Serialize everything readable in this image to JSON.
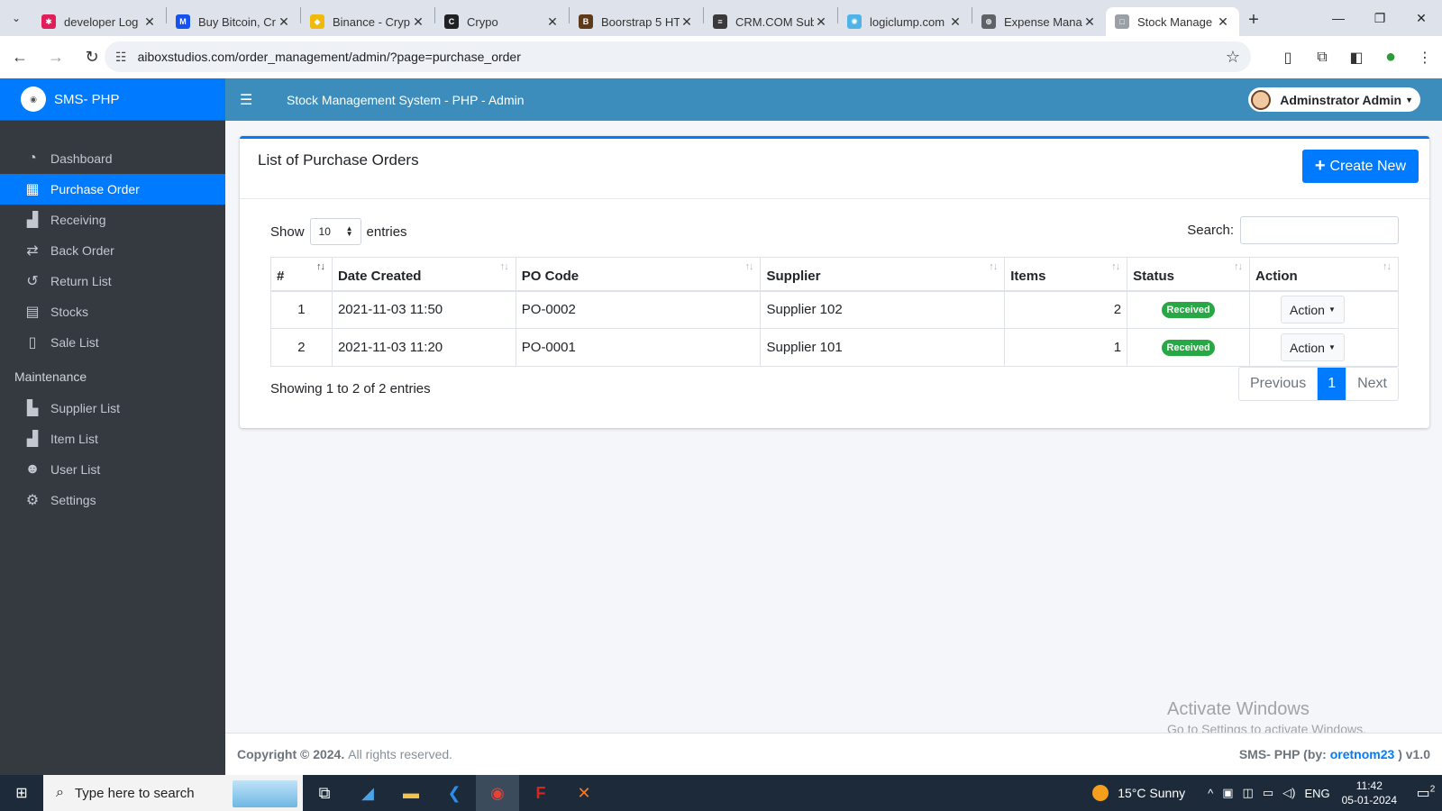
{
  "browser": {
    "tabs": [
      {
        "title": "developer Log",
        "fav_color": "#e01e5a",
        "fav": "✱",
        "active": false
      },
      {
        "title": "Buy Bitcoin, Cr",
        "fav_color": "#1652f0",
        "fav": "M",
        "active": false
      },
      {
        "title": "Binance - Cryp",
        "fav_color": "#f0b90b",
        "fav": "◆",
        "active": false
      },
      {
        "title": "Crypo",
        "fav_color": "#202124",
        "fav": "C",
        "active": false
      },
      {
        "title": "Boorstrap 5 HT",
        "fav_color": "#5c3a1a",
        "fav": "B",
        "active": false
      },
      {
        "title": "CRM.COM Sub",
        "fav_color": "#3a3a3a",
        "fav": "≡",
        "active": false
      },
      {
        "title": "logiclump.com",
        "fav_color": "#4fb3e8",
        "fav": "✺",
        "active": false
      },
      {
        "title": "Expense Mana",
        "fav_color": "#5f6368",
        "fav": "⊕",
        "active": false
      },
      {
        "title": "Stock Manage",
        "fav_color": "#9aa0a6",
        "fav": "□",
        "active": true
      }
    ],
    "url": "aiboxstudios.com/order_management/admin/?page=purchase_order"
  },
  "sidebar": {
    "brand": "SMS- PHP",
    "items": [
      {
        "label": "Dashboard",
        "icon": "tachometer-icon",
        "glyph": "◔",
        "active": false
      },
      {
        "label": "Purchase Order",
        "icon": "table-icon",
        "glyph": "▦",
        "active": true
      },
      {
        "label": "Receiving",
        "icon": "boxes-icon",
        "glyph": "▟",
        "active": false
      },
      {
        "label": "Back Order",
        "icon": "exchange-icon",
        "glyph": "⇄",
        "active": false
      },
      {
        "label": "Return List",
        "icon": "undo-icon",
        "glyph": "↺",
        "active": false
      },
      {
        "label": "Stocks",
        "icon": "grid-icon",
        "glyph": "▤",
        "active": false
      },
      {
        "label": "Sale List",
        "icon": "file-dollar-icon",
        "glyph": "▯",
        "active": false
      }
    ],
    "maintenance_header": "Maintenance",
    "maintenance_items": [
      {
        "label": "Supplier List",
        "icon": "truck-loading-icon",
        "glyph": "▙",
        "active": false
      },
      {
        "label": "Item List",
        "icon": "boxes-icon",
        "glyph": "▟",
        "active": false
      },
      {
        "label": "User List",
        "icon": "users-icon",
        "glyph": "☻",
        "active": false
      },
      {
        "label": "Settings",
        "icon": "cogs-icon",
        "glyph": "⚙",
        "active": false
      }
    ]
  },
  "topbar": {
    "title": "Stock Management System - PHP - Admin",
    "user": "Adminstrator Admin"
  },
  "card": {
    "title": "List of Purchase Orders",
    "create_label": "Create New",
    "show_label": "Show",
    "entries_label": "entries",
    "page_length": "10",
    "search_label": "Search:",
    "search_value": "",
    "columns": [
      "#",
      "Date Created",
      "PO Code",
      "Supplier",
      "Items",
      "Status",
      "Action"
    ],
    "rows": [
      {
        "n": "1",
        "date": "2021-11-03 11:50",
        "code": "PO-0002",
        "supplier": "Supplier 102",
        "items": "2",
        "status": "Received",
        "action": "Action"
      },
      {
        "n": "2",
        "date": "2021-11-03 11:20",
        "code": "PO-0001",
        "supplier": "Supplier 101",
        "items": "1",
        "status": "Received",
        "action": "Action"
      }
    ],
    "info": "Showing 1 to 2 of 2 entries",
    "pager": {
      "prev": "Previous",
      "current": "1",
      "next": "Next"
    }
  },
  "footer": {
    "copyright": "Copyright © 2024.",
    "rights": "All rights reserved.",
    "credit_prefix": "SMS- PHP (by:",
    "credit_author": "oretnom23",
    "credit_suffix": ") v1.0"
  },
  "watermark": {
    "line1": "Activate Windows",
    "line2": "Go to Settings to activate Windows."
  },
  "taskbar": {
    "search_placeholder": "Type here to search",
    "weather": "15°C  Sunny",
    "lang": "ENG",
    "time": "11:42",
    "date": "05-01-2024",
    "notifications": "2"
  }
}
